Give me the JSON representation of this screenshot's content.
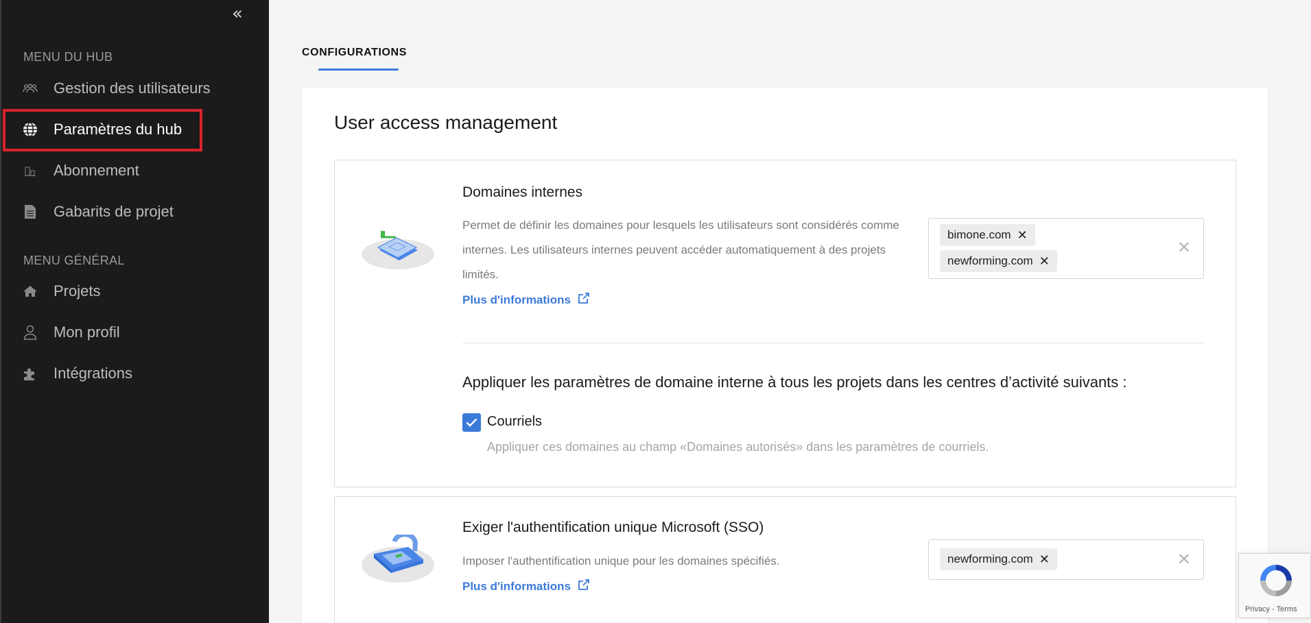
{
  "sidebar": {
    "collapse_icon": "«",
    "hub_menu_title": "MENU DU HUB",
    "general_menu_title": "MENU GÉNÉRAL",
    "hub_items": [
      {
        "label": "Gestion des utilisateurs",
        "icon": "users-icon"
      },
      {
        "label": "Paramètres du hub",
        "icon": "globe-icon",
        "active": true
      },
      {
        "label": "Abonnement",
        "icon": "chart-icon"
      },
      {
        "label": "Gabarits de projet",
        "icon": "document-icon"
      }
    ],
    "general_items": [
      {
        "label": "Projets",
        "icon": "home-icon"
      },
      {
        "label": "Mon profil",
        "icon": "user-icon"
      },
      {
        "label": "Intégrations",
        "icon": "puzzle-icon"
      }
    ]
  },
  "main": {
    "tab_label": "CONFIGURATIONS",
    "panel_title": "User access management",
    "internal_domains": {
      "title": "Domaines internes",
      "description": "Permet de définir les domaines pour lesquels les utilisateurs sont considérés comme internes. Les utilisateurs internes peuvent accéder automatiquement à des projets limités.",
      "more_info": "Plus d'informations",
      "domains": [
        "bimone.com",
        "newforming.com"
      ],
      "apply_title": "Appliquer les paramètres de domaine interne à tous les projets dans les centres d’activité suivants :",
      "checkbox_label": "Courriels",
      "checkbox_checked": true,
      "checkbox_help": "Appliquer ces domaines au champ «Domaines autorisés» dans les paramètres de courriels."
    },
    "sso": {
      "title": "Exiger l'authentification unique Microsoft (SSO)",
      "description": "Imposer l'authentification unique pour les domaines spécifiés.",
      "more_info": "Plus d'informations",
      "domains": [
        "newforming.com"
      ]
    }
  },
  "recaptcha": {
    "links": "Privacy - Terms"
  },
  "colors": {
    "sidebar_bg": "#1b1b1b",
    "accent": "#3b7ad9",
    "active_highlight": "#d8232a"
  }
}
